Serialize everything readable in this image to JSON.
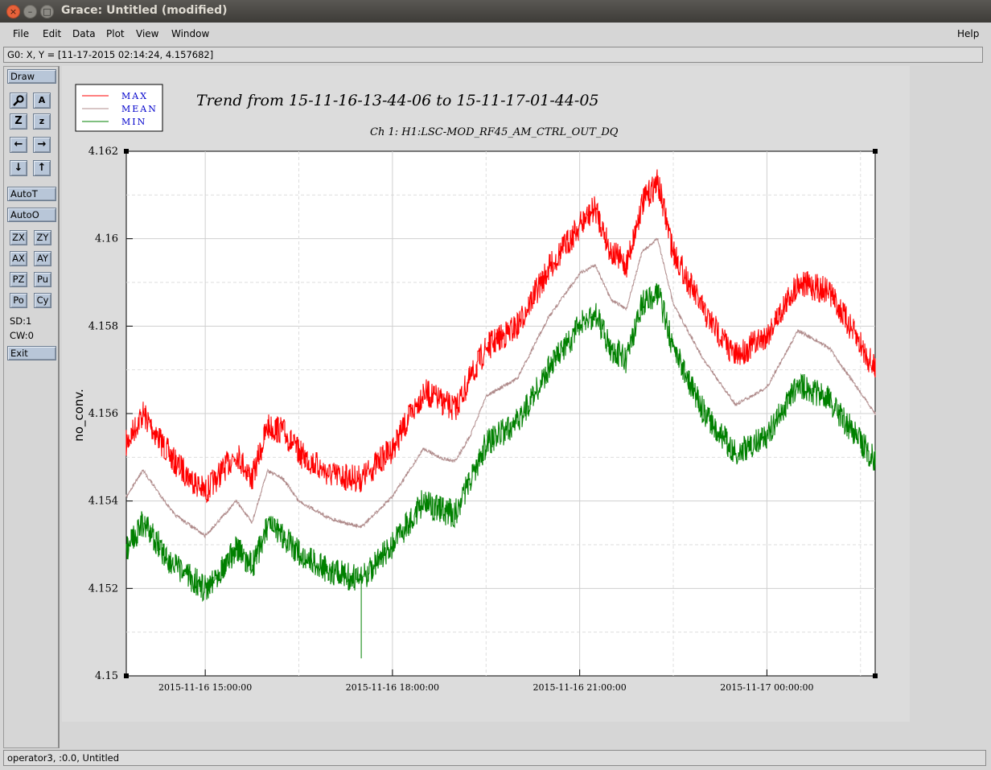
{
  "window": {
    "title": "Grace: Untitled (modified)",
    "close_glyph": "×",
    "min_glyph": "–",
    "max_glyph": "□"
  },
  "menubar": {
    "items": [
      "File",
      "Edit",
      "Data",
      "Plot",
      "View",
      "Window"
    ],
    "help": "Help"
  },
  "coord_readout": "G0: X, Y = [11-17-2015 02:14:24, 4.157682]",
  "toolbar": {
    "draw": "Draw",
    "autot": "AutoT",
    "autoo": "AutoO",
    "zx": "ZX",
    "zy": "ZY",
    "ax": "AX",
    "ay": "AY",
    "pz": "PZ",
    "pu": "Pu",
    "po": "Po",
    "cy": "Cy",
    "sd": "SD:1",
    "cw": "CW:0",
    "exit": "Exit",
    "icons": [
      "zoom-icon",
      "text-annotate-icon",
      "zoom-box-icon",
      "zoom-z-icon",
      "left-arrow-icon",
      "right-arrow-icon",
      "down-arrow-icon",
      "up-arrow-icon"
    ],
    "icon_glyphs": {
      "zoom": "🔍",
      "text": "A",
      "zoombox": "Z",
      "zoomz": "z",
      "left": "←",
      "right": "→",
      "down": "↓",
      "up": "↑"
    }
  },
  "status": "operator3, :0.0, Untitled",
  "colors": {
    "max": "#ff0000",
    "mean": "#b08c8c",
    "min": "#008000",
    "button": "#b8c6d8",
    "plot_bg": "#ffffff",
    "page_bg": "#dcdcdc"
  },
  "chart_data": {
    "type": "line",
    "title": "Trend from 15-11-16-13-44-06 to 15-11-17-01-44-05",
    "subtitle": "Ch 1: H1:LSC-MOD_RF45_AM_CTRL_OUT_DQ",
    "ylabel": "no_conv.",
    "xlabel": "",
    "xlim": [
      "2015-11-16 13:44:06",
      "2015-11-17 01:44:05"
    ],
    "ylim": [
      4.15,
      4.162
    ],
    "y_ticks": [
      "4.15",
      "4.152",
      "4.154",
      "4.156",
      "4.158",
      "4.16",
      "4.162"
    ],
    "x_ticks": [
      "2015-11-16 15:00:00",
      "2015-11-16 18:00:00",
      "2015-11-16 21:00:00",
      "2015-11-17 00:00:00"
    ],
    "x_tick_times": [
      "2015-11-16 15:00:00",
      "2015-11-16 18:00:00",
      "2015-11-16 21:00:00",
      "2015-11-17 00:00:00"
    ],
    "grid": true,
    "legend_position": "top-left",
    "x": [
      "2015-11-16 13:44",
      "2015-11-16 14:00",
      "2015-11-16 14:30",
      "2015-11-16 15:00",
      "2015-11-16 15:30",
      "2015-11-16 15:45",
      "2015-11-16 16:00",
      "2015-11-16 16:15",
      "2015-11-16 16:30",
      "2015-11-16 17:00",
      "2015-11-16 17:30",
      "2015-11-16 18:00",
      "2015-11-16 18:30",
      "2015-11-16 18:45",
      "2015-11-16 19:00",
      "2015-11-16 19:15",
      "2015-11-16 19:30",
      "2015-11-16 20:00",
      "2015-11-16 20:30",
      "2015-11-16 21:00",
      "2015-11-16 21:15",
      "2015-11-16 21:30",
      "2015-11-16 21:45",
      "2015-11-16 22:00",
      "2015-11-16 22:15",
      "2015-11-16 22:30",
      "2015-11-16 23:00",
      "2015-11-16 23:30",
      "2015-11-17 00:00",
      "2015-11-17 00:30",
      "2015-11-17 01:00",
      "2015-11-17 01:44"
    ],
    "series": [
      {
        "name": "MAX",
        "color": "#ff0000",
        "values": [
          4.1553,
          4.156,
          4.1549,
          4.1542,
          4.1551,
          4.1545,
          4.1557,
          4.1556,
          4.1551,
          4.1546,
          4.1545,
          4.1552,
          4.1565,
          4.1563,
          4.1561,
          4.1568,
          4.1575,
          4.158,
          4.1593,
          4.1603,
          4.1607,
          4.1597,
          4.1594,
          4.1608,
          4.1613,
          4.1597,
          4.1583,
          4.1573,
          4.1578,
          4.159,
          4.1588,
          4.157
        ]
      },
      {
        "name": "MEAN",
        "color": "#b08c8c",
        "values": [
          4.1541,
          4.1547,
          4.1537,
          4.1532,
          4.154,
          4.1535,
          4.1547,
          4.1545,
          4.154,
          4.1536,
          4.1534,
          4.1541,
          4.1552,
          4.155,
          4.1549,
          4.1555,
          4.1564,
          4.1568,
          4.1582,
          4.1592,
          4.1594,
          4.1586,
          4.1584,
          4.1597,
          4.16,
          4.1585,
          4.1572,
          4.1562,
          4.1566,
          4.1579,
          4.1575,
          4.156
        ]
      },
      {
        "name": "MIN",
        "color": "#008000",
        "values": [
          4.1529,
          4.1535,
          4.1525,
          4.152,
          4.1529,
          4.1525,
          4.1534,
          4.1532,
          4.1528,
          4.1524,
          4.1522,
          4.153,
          4.154,
          4.1538,
          4.1537,
          4.1545,
          4.1553,
          4.1558,
          4.157,
          4.158,
          4.1583,
          4.1575,
          4.1572,
          4.1585,
          4.1588,
          4.1575,
          4.156,
          4.1551,
          4.1555,
          4.1567,
          4.1563,
          4.1549
        ]
      }
    ],
    "annotation_spike": {
      "x": "2015-11-16 17:30",
      "y": 4.1504
    }
  }
}
